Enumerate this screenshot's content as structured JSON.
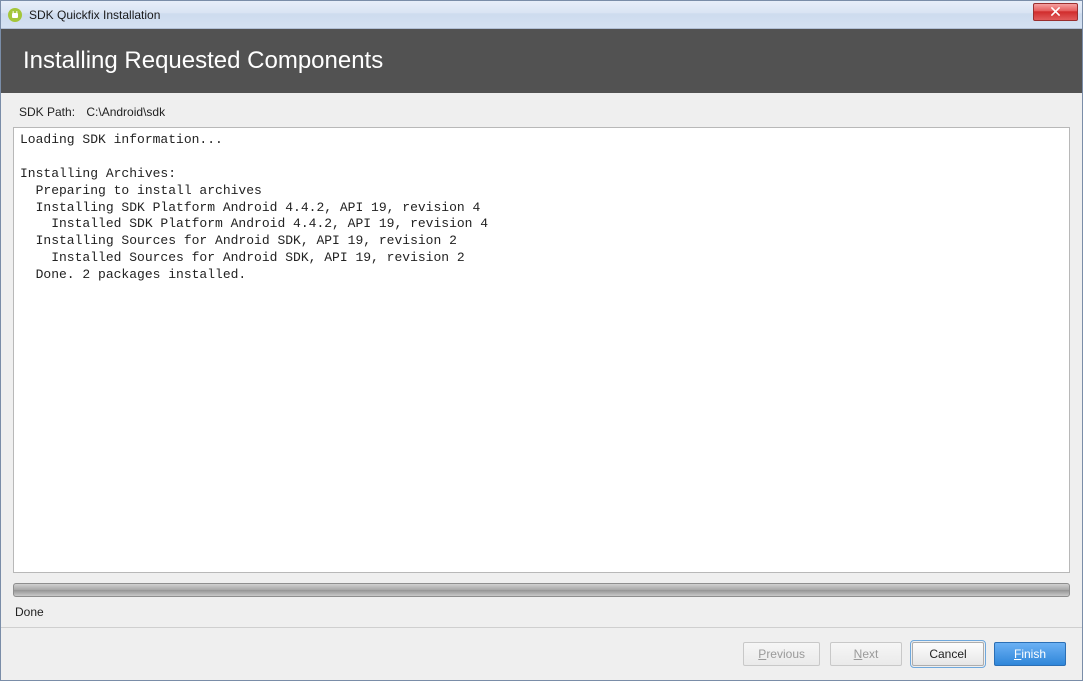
{
  "window": {
    "title": "SDK Quickfix Installation"
  },
  "header": {
    "title": "Installing Requested Components"
  },
  "sdk": {
    "path_label": "SDK Path:",
    "path_value": "C:\\Android\\sdk"
  },
  "log": {
    "text": "Loading SDK information...\n\nInstalling Archives:\n  Preparing to install archives\n  Installing SDK Platform Android 4.4.2, API 19, revision 4\n    Installed SDK Platform Android 4.4.2, API 19, revision 4\n  Installing Sources for Android SDK, API 19, revision 2\n    Installed Sources for Android SDK, API 19, revision 2\n  Done. 2 packages installed."
  },
  "status": {
    "text": "Done"
  },
  "footer": {
    "previous_prefix": "P",
    "previous_rest": "revious",
    "next_prefix": "N",
    "next_rest": "ext",
    "cancel": "Cancel",
    "finish_prefix": "F",
    "finish_rest": "inish"
  }
}
